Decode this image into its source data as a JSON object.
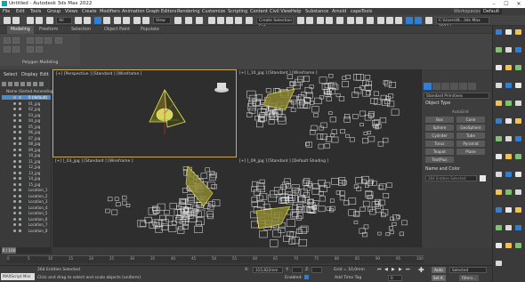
{
  "window": {
    "title": "Untitled - Autodesk 3ds Max 2022",
    "minimize": "–",
    "maximize": "☐",
    "close": "✕"
  },
  "menu": [
    "File",
    "Edit",
    "Tools",
    "Group",
    "Views",
    "Create",
    "Modifiers",
    "Animation",
    "Graph Editors",
    "Rendering",
    "Customize",
    "Scripting",
    "Content",
    "Civil View",
    "Help",
    "Substance",
    "Arnold",
    "capeTools"
  ],
  "workspaces": {
    "label": "Workspaces:",
    "value": "Default"
  },
  "toolbar": {
    "filter": "All",
    "view": "View",
    "selection_set": "Create Selection Set",
    "path": "C:\\Users\\N...3ds Max 2022 \\"
  },
  "ribbon": {
    "tabs": [
      "Modeling",
      "Freeform",
      "Selection",
      "Object Paint",
      "Populate"
    ],
    "active": "Modeling",
    "panel_label": "Polygon Modeling"
  },
  "scene_explorer": {
    "tabs": [
      "Select",
      "Display",
      "Edit"
    ],
    "header": "Name (Sorted Ascending)",
    "rows": [
      "0 (default)",
      "01_jpg",
      "02_jpg",
      "03_jpg",
      "04_jpg",
      "05_jpg",
      "06_jpg",
      "07_jpg",
      "08_jpg",
      "09_jpg",
      "10_jpg",
      "11_jpg",
      "12_jpg",
      "13_jpg",
      "14_jpg",
      "15_jpg",
      "Location_1",
      "Location_2",
      "Location_3",
      "Location_4",
      "Location_5",
      "Location_6",
      "Location_7",
      "Location_8"
    ]
  },
  "viewports": {
    "top_left": "[+] [Perspective ] [Standard ] [Wireframe ]",
    "top_right": "[+] [_10_jpg ] [Standard ] [Wireframe ]",
    "bottom_left": "[+] [_03_jpg ] [Standard ] [Wireframe ]",
    "bottom_right": "[+] [_09_jpg ] [Standard ] [Default Shading ]"
  },
  "command_panel": {
    "dropdown": "Standard Primitives",
    "object_type_title": "Object Type",
    "autogrid": "AutoGrid",
    "buttons": [
      "Box",
      "Cone",
      "Sphere",
      "GeoSphere",
      "Cylinder",
      "Tube",
      "Torus",
      "Pyramid",
      "Teapot",
      "Plane",
      "TextPlus"
    ],
    "name_color_title": "Name and Color",
    "name_field": "264 Entities Selected"
  },
  "timeline": {
    "frame": "0 / 100",
    "ticks": [
      "0",
      "5",
      "10",
      "15",
      "20",
      "25",
      "30",
      "35",
      "40",
      "45",
      "50",
      "55",
      "60",
      "65",
      "70",
      "75",
      "80",
      "85",
      "90",
      "95",
      "100"
    ]
  },
  "status": {
    "maxscript": "MAXScript Mini",
    "entities": "264 Entities Selected",
    "prompt": "Click and drag to select and scale objects (uniform)",
    "x_label": "X:",
    "x_value": "315,822mm",
    "y_label": "Y:",
    "z_label": "Z:",
    "grid": "Grid = 10,0mm",
    "enabled": "Enabled:",
    "add_time_tag": "Add Time Tag",
    "auto": "Auto",
    "set_k": "Set K.",
    "selected": "Selected",
    "filters": "Filters...",
    "frame_value": "0"
  }
}
